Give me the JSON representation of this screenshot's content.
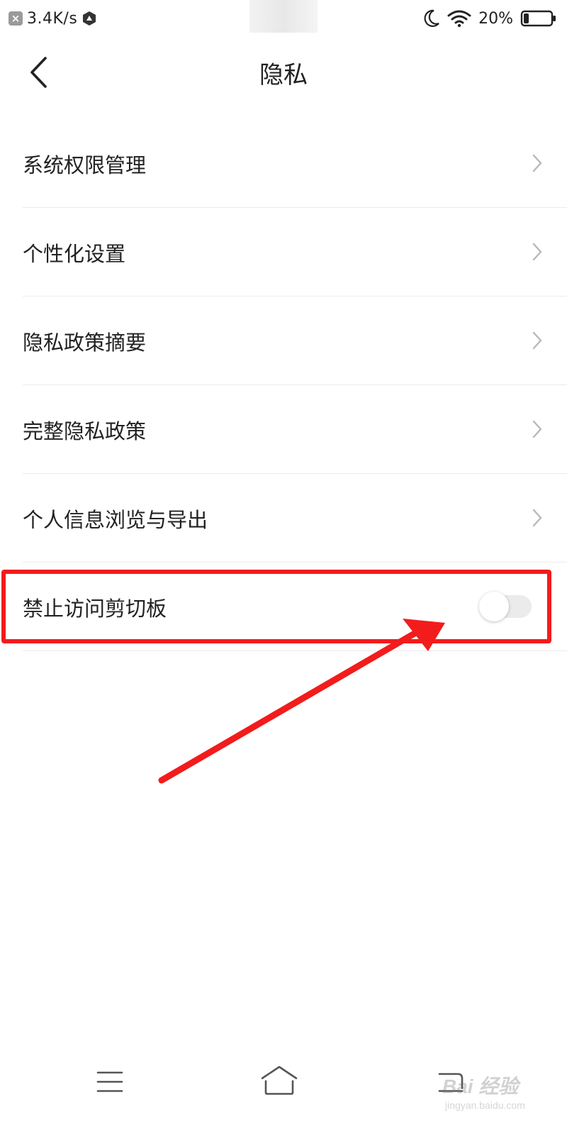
{
  "status_bar": {
    "notification_icon": "x-notification-icon",
    "network_speed": "3.4K/s",
    "app_icon": "app-shield-icon",
    "moon_icon": "moon-icon",
    "wifi_icon": "wifi-icon",
    "battery_percent": "20%",
    "battery_level": 0.2,
    "battery_icon": "battery-icon"
  },
  "header": {
    "back_icon": "chevron-left-icon",
    "title": "隐私"
  },
  "settings": {
    "items": [
      {
        "label": "系统权限管理",
        "control": "chevron-right-icon"
      },
      {
        "label": "个性化设置",
        "control": "chevron-right-icon"
      },
      {
        "label": "隐私政策摘要",
        "control": "chevron-right-icon"
      },
      {
        "label": "完整隐私政策",
        "control": "chevron-right-icon"
      },
      {
        "label": "个人信息浏览与导出",
        "control": "chevron-right-icon"
      },
      {
        "label": "禁止访问剪切板",
        "control": "toggle-switch",
        "enabled": false
      }
    ]
  },
  "annotation": {
    "color": "#f21c1c",
    "arrow_icon": "red-arrow-icon",
    "highlight_icon": "red-highlight-box"
  },
  "nav_bar": {
    "menu_icon": "hamburger-menu-icon",
    "home_icon": "home-icon",
    "back_icon": "back-icon"
  },
  "watermark": {
    "main": "Bai 经验",
    "sub": "jingyan.baidu.com"
  }
}
